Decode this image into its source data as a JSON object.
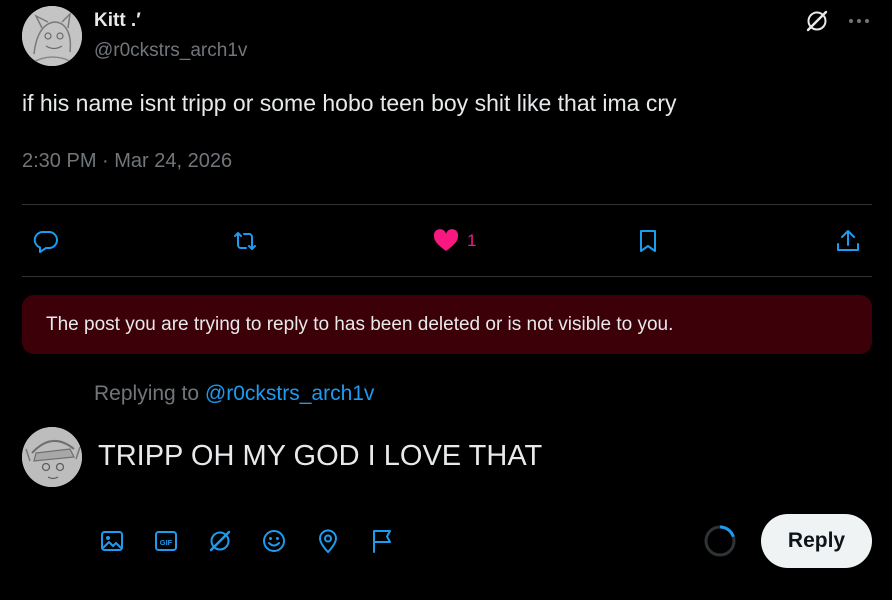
{
  "post": {
    "author": {
      "name": "Kitt .′",
      "handle": "@r0ckstrs_arch1v"
    },
    "text": "if his name isnt tripp or some hobo teen boy shit like that ima cry",
    "meta": "2:30 PM · Mar 24, 2026",
    "actions": {
      "reply_icon": "reply-icon",
      "repost_icon": "repost-icon",
      "like_icon": "heart-filled-icon",
      "like_count": "1",
      "bookmark_icon": "bookmark-icon",
      "share_icon": "share-icon"
    }
  },
  "error_banner": {
    "text": "The post you are trying to reply to has been deleted or is not visible to you."
  },
  "composer": {
    "replying_prefix": "Replying to ",
    "replying_to": "@r0ckstrs_arch1v",
    "text": "TRIPP OH MY GOD I LOVE THAT",
    "tools": [
      "media-icon",
      "gif-icon",
      "grok-icon",
      "emoji-icon",
      "location-icon",
      "poll-icon"
    ],
    "progress": 0.2,
    "reply_label": "Reply"
  },
  "colors": {
    "background": "#000000",
    "text": "#e7e9ea",
    "muted": "#71767b",
    "accent": "#1d9bf0",
    "like": "#f91880",
    "error_bg": "#3c0008",
    "button_bg": "#eff3f4"
  }
}
